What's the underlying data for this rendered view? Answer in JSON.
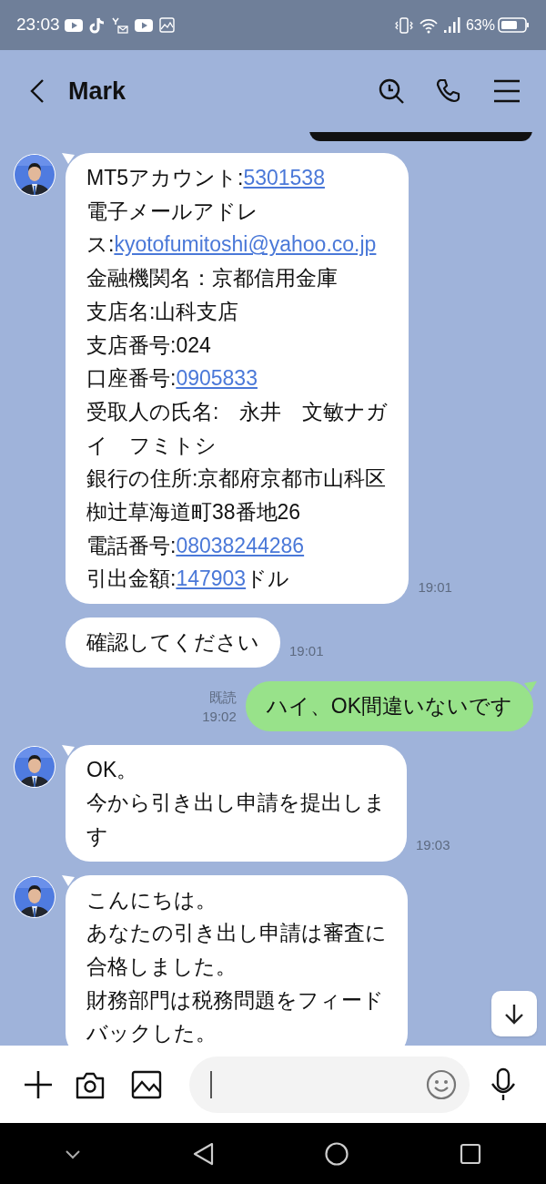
{
  "status_bar": {
    "time": "23:03",
    "battery": "63%"
  },
  "header": {
    "title": "Mark"
  },
  "messages": [
    {
      "kind": "received",
      "first_in_group": true,
      "time": "19:01",
      "lines": [
        [
          {
            "text": "MT5アカウント:",
            "link": false
          },
          {
            "text": "5301538",
            "link": true
          }
        ],
        [
          {
            "text": "電子メールアドレ",
            "link": false
          }
        ],
        [
          {
            "text": "ス:",
            "link": false
          },
          {
            "text": "kyotofumitoshi@yahoo.co.jp",
            "link": true
          }
        ],
        [
          {
            "text": "金融機関名：京都信用金庫",
            "link": false
          }
        ],
        [
          {
            "text": "支店名:山科支店",
            "link": false
          }
        ],
        [
          {
            "text": "支店番号:024",
            "link": false
          }
        ],
        [
          {
            "text": "口座番号:",
            "link": false
          },
          {
            "text": "0905833",
            "link": true
          }
        ],
        [
          {
            "text": "受取人の氏名:　永井　文敏ナガ",
            "link": false
          }
        ],
        [
          {
            "text": "イ　フミトシ",
            "link": false
          }
        ],
        [
          {
            "text": "銀行の住所:京都府京都市山科区",
            "link": false
          }
        ],
        [
          {
            "text": "椥辻草海道町38番地26",
            "link": false
          }
        ],
        [
          {
            "text": "電話番号:",
            "link": false
          },
          {
            "text": "08038244286",
            "link": true
          }
        ],
        [
          {
            "text": "引出金額:",
            "link": false
          },
          {
            "text": "147903",
            "link": true
          },
          {
            "text": "ドル",
            "link": false
          }
        ]
      ]
    },
    {
      "kind": "received",
      "first_in_group": false,
      "time": "19:01",
      "lines": [
        [
          {
            "text": "確認してください",
            "link": false
          }
        ]
      ]
    },
    {
      "kind": "sent",
      "first_in_group": true,
      "read": "既読",
      "time": "19:02",
      "lines": [
        [
          {
            "text": "ハイ、OK間違いないです",
            "link": false
          }
        ]
      ]
    },
    {
      "kind": "received",
      "first_in_group": true,
      "time": "19:03",
      "lines": [
        [
          {
            "text": "OK。",
            "link": false
          }
        ],
        [
          {
            "text": "今から引き出し申請を提出しま",
            "link": false
          }
        ],
        [
          {
            "text": "す",
            "link": false
          }
        ]
      ]
    },
    {
      "kind": "received",
      "first_in_group": true,
      "lines": [
        [
          {
            "text": "こんにちは。",
            "link": false
          }
        ],
        [
          {
            "text": "あなたの引き出し申請は審査に",
            "link": false
          }
        ],
        [
          {
            "text": "合格しました。",
            "link": false
          }
        ],
        [
          {
            "text": "財務部門は税務問題をフィード",
            "link": false
          }
        ],
        [
          {
            "text": "バックした。",
            "link": false
          }
        ]
      ]
    }
  ]
}
